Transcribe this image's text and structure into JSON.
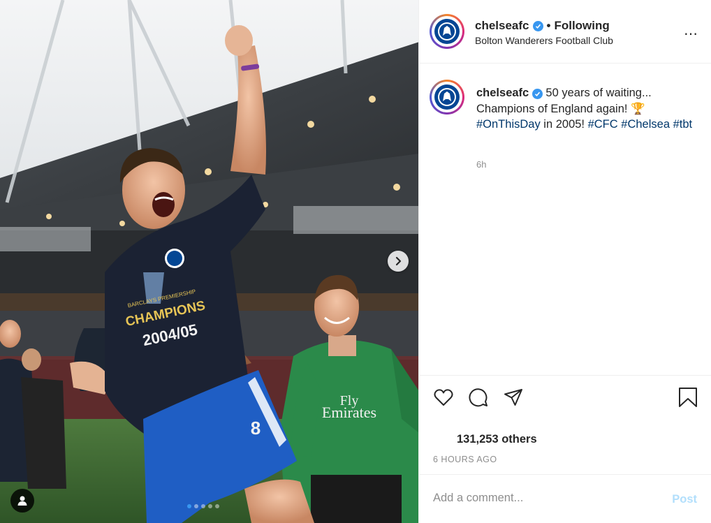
{
  "post": {
    "username": "chelseafc",
    "separator": "•",
    "follow_status": "Following",
    "location": "Bolton Wanderers Football Club",
    "more_icon": "⋯",
    "caption_text": "50 years of waiting... Champions of England again! 🏆",
    "caption_hashtag_1": "#OnThisDay",
    "caption_mid": " in 2005! ",
    "caption_hashtag_2": "#CFC",
    "caption_hashtag_3": "#Chelsea",
    "caption_hashtag_4": "#tbt",
    "caption_time": "6h",
    "likes": "131,253 others",
    "time_ago": "6 HOURS AGO",
    "comment_placeholder": "Add a comment...",
    "post_label": "Post"
  },
  "photo": {
    "shirt_text_1": "BARCLAYS PREMIERSHIP",
    "shirt_text_2": "CHAMPIONS",
    "shirt_text_3": "2004/05",
    "shorts_number": "8",
    "keeper_sponsor_1": "Fly",
    "keeper_sponsor_2": "Emirates"
  },
  "carousel": {
    "count": 5,
    "active": 1
  },
  "colors": {
    "accent": "#3897f0",
    "hashtag": "#00376b",
    "chelsea_blue": "#034694",
    "post_disabled": "#b2dffc"
  },
  "icons": [
    "chevron-right-icon",
    "user-tag-icon",
    "verified-icon",
    "heart-icon",
    "comment-icon",
    "share-icon",
    "bookmark-icon",
    "more-icon"
  ]
}
